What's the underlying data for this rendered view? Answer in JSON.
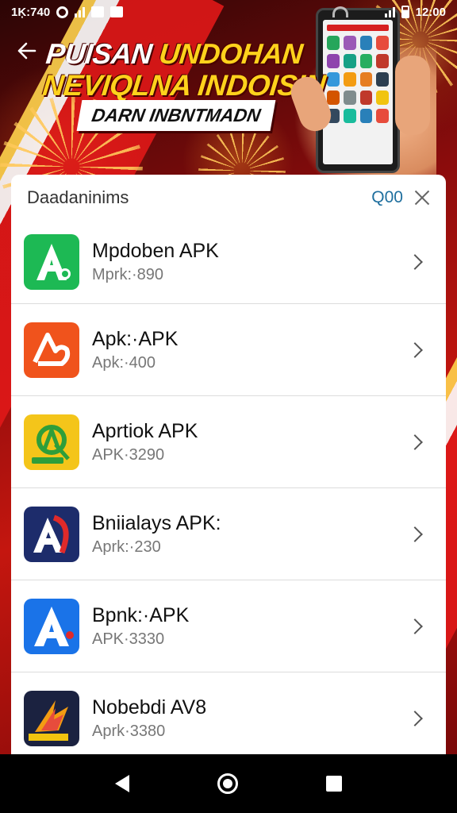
{
  "status_bar": {
    "time": "1Ķ:740",
    "right_text": "12:00",
    "left_icons": [
      "target-icon",
      "signal-icon",
      "image-icon",
      "app-icon"
    ],
    "right_icons": [
      "wifi-icon",
      "signal-icon",
      "battery-icon"
    ]
  },
  "header": {
    "back_icon": "arrow-left-icon",
    "headline_line1_a": "PUISAN",
    "headline_line1_b": "UNDOHAN",
    "headline_line2": "NEVIQLNA INDOISIN",
    "subtitle": "DARN INBNTMADN"
  },
  "sheet": {
    "title": "Daadaninims",
    "count": "Q00",
    "close_icon": "close-icon"
  },
  "apps": [
    {
      "name": "Mpdoben APK",
      "size": "Mprk:·890",
      "icon": "green-a-icon",
      "color": "#1db954"
    },
    {
      "name": "Apk:·APK",
      "size": "Apk:·400",
      "icon": "orange-arch-icon",
      "color": "#f0531c"
    },
    {
      "name": "Aprtiok APK",
      "size": "APK·3290",
      "icon": "yellow-a-icon",
      "color": "#f4c51a"
    },
    {
      "name": "Bniialays APK:",
      "size": "Aprk:·230",
      "icon": "navy-red-a-icon",
      "color": "#1d2c6b"
    },
    {
      "name": "Bpnk:·APK",
      "size": "APK·3330",
      "icon": "blue-a-icon",
      "color": "#1a73e8"
    },
    {
      "name": "Nobebdi AV8",
      "size": "Aprk·3380",
      "icon": "dark-flame-icon",
      "color": "#1b2240"
    }
  ],
  "nav": {
    "back_icon": "nav-back-icon",
    "home_icon": "nav-home-icon",
    "recents_icon": "nav-recents-icon"
  }
}
